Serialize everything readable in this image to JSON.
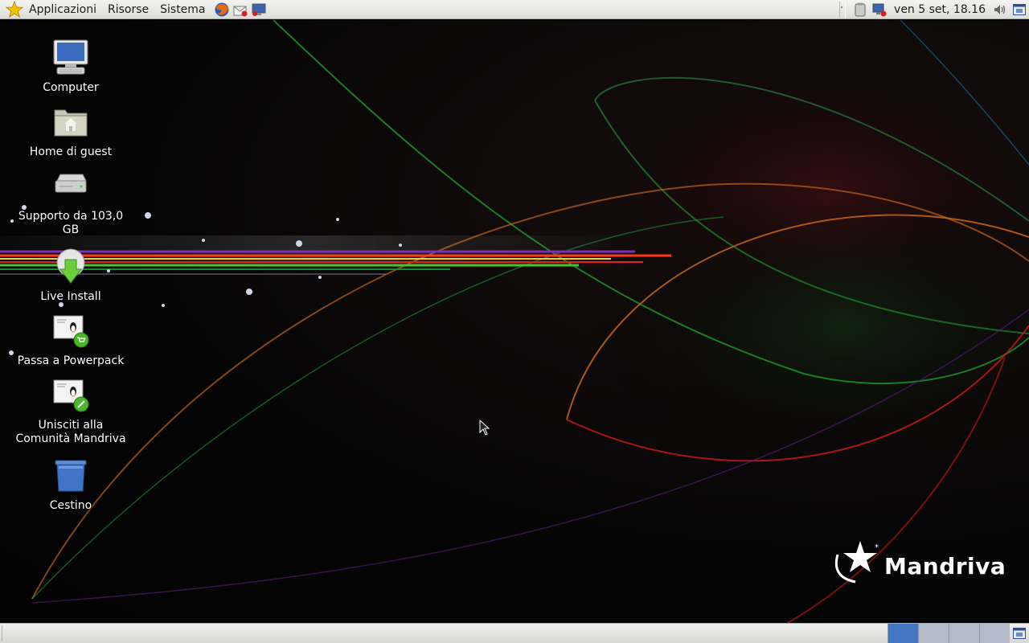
{
  "top_panel": {
    "menus": [
      "Applicazioni",
      "Risorse",
      "Sistema"
    ],
    "clock": "ven  5 set, 18.16"
  },
  "desktop_icons": [
    {
      "label": "Computer",
      "icon": "computer-icon"
    },
    {
      "label": "Home di guest",
      "icon": "home-folder-icon"
    },
    {
      "label": "Supporto da 103,0 GB",
      "icon": "hard-drive-icon"
    },
    {
      "label": "Live Install",
      "icon": "live-install-icon"
    },
    {
      "label": "Passa a Powerpack",
      "icon": "powerpack-icon"
    },
    {
      "label": "Unisciti alla Comunità Mandriva",
      "icon": "community-icon"
    },
    {
      "label": "Cestino",
      "icon": "trash-icon"
    }
  ],
  "logo": {
    "text": "Mandriva"
  },
  "colors": {
    "panel": "#e4e4e0",
    "workspace_active": "#4477c4",
    "workspace_inactive": "#b4bccb"
  }
}
